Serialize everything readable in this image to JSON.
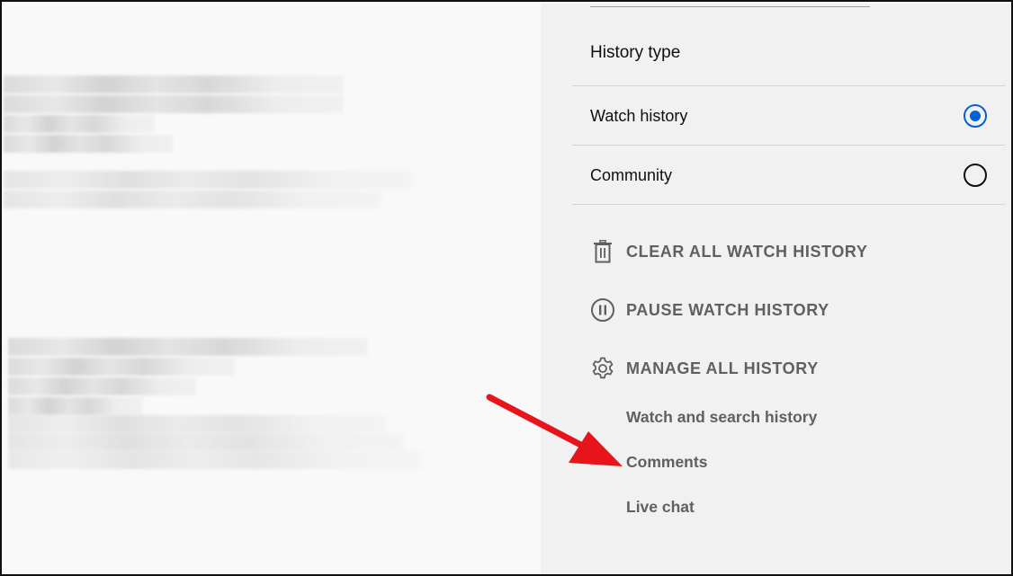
{
  "history_panel": {
    "section_title": "History type",
    "options": [
      {
        "label": "Watch history",
        "selected": true
      },
      {
        "label": "Community",
        "selected": false
      }
    ],
    "actions": [
      {
        "label": "CLEAR ALL WATCH HISTORY",
        "icon": "trash-icon"
      },
      {
        "label": "PAUSE WATCH HISTORY",
        "icon": "pause-circle-icon"
      },
      {
        "label": "MANAGE ALL HISTORY",
        "icon": "gear-icon"
      }
    ],
    "manage_links": [
      {
        "label": "Watch and search history"
      },
      {
        "label": "Comments"
      },
      {
        "label": "Live chat"
      }
    ]
  },
  "colors": {
    "accent": "#065fd4",
    "annotation_arrow": "#e8141b",
    "panel_bg": "#f1f1f1"
  }
}
